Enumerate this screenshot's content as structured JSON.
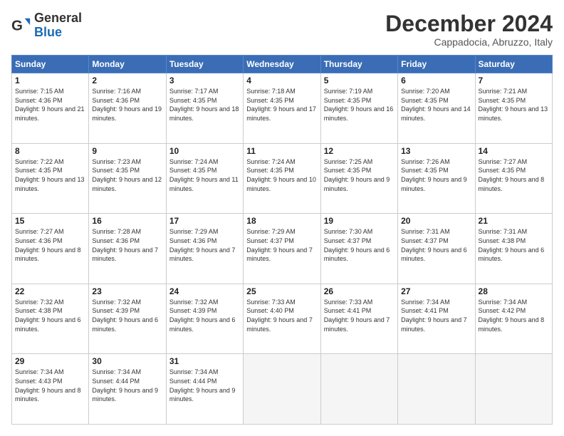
{
  "header": {
    "logo_general": "General",
    "logo_blue": "Blue",
    "month_title": "December 2024",
    "location": "Cappadocia, Abruzzo, Italy"
  },
  "days_of_week": [
    "Sunday",
    "Monday",
    "Tuesday",
    "Wednesday",
    "Thursday",
    "Friday",
    "Saturday"
  ],
  "weeks": [
    [
      {
        "day": "1",
        "sunrise": "7:15 AM",
        "sunset": "4:36 PM",
        "daylight": "9 hours and 21 minutes."
      },
      {
        "day": "2",
        "sunrise": "7:16 AM",
        "sunset": "4:36 PM",
        "daylight": "9 hours and 19 minutes."
      },
      {
        "day": "3",
        "sunrise": "7:17 AM",
        "sunset": "4:35 PM",
        "daylight": "9 hours and 18 minutes."
      },
      {
        "day": "4",
        "sunrise": "7:18 AM",
        "sunset": "4:35 PM",
        "daylight": "9 hours and 17 minutes."
      },
      {
        "day": "5",
        "sunrise": "7:19 AM",
        "sunset": "4:35 PM",
        "daylight": "9 hours and 16 minutes."
      },
      {
        "day": "6",
        "sunrise": "7:20 AM",
        "sunset": "4:35 PM",
        "daylight": "9 hours and 14 minutes."
      },
      {
        "day": "7",
        "sunrise": "7:21 AM",
        "sunset": "4:35 PM",
        "daylight": "9 hours and 13 minutes."
      }
    ],
    [
      {
        "day": "8",
        "sunrise": "7:22 AM",
        "sunset": "4:35 PM",
        "daylight": "9 hours and 13 minutes."
      },
      {
        "day": "9",
        "sunrise": "7:23 AM",
        "sunset": "4:35 PM",
        "daylight": "9 hours and 12 minutes."
      },
      {
        "day": "10",
        "sunrise": "7:24 AM",
        "sunset": "4:35 PM",
        "daylight": "9 hours and 11 minutes."
      },
      {
        "day": "11",
        "sunrise": "7:24 AM",
        "sunset": "4:35 PM",
        "daylight": "9 hours and 10 minutes."
      },
      {
        "day": "12",
        "sunrise": "7:25 AM",
        "sunset": "4:35 PM",
        "daylight": "9 hours and 9 minutes."
      },
      {
        "day": "13",
        "sunrise": "7:26 AM",
        "sunset": "4:35 PM",
        "daylight": "9 hours and 9 minutes."
      },
      {
        "day": "14",
        "sunrise": "7:27 AM",
        "sunset": "4:35 PM",
        "daylight": "9 hours and 8 minutes."
      }
    ],
    [
      {
        "day": "15",
        "sunrise": "7:27 AM",
        "sunset": "4:36 PM",
        "daylight": "9 hours and 8 minutes."
      },
      {
        "day": "16",
        "sunrise": "7:28 AM",
        "sunset": "4:36 PM",
        "daylight": "9 hours and 7 minutes."
      },
      {
        "day": "17",
        "sunrise": "7:29 AM",
        "sunset": "4:36 PM",
        "daylight": "9 hours and 7 minutes."
      },
      {
        "day": "18",
        "sunrise": "7:29 AM",
        "sunset": "4:37 PM",
        "daylight": "9 hours and 7 minutes."
      },
      {
        "day": "19",
        "sunrise": "7:30 AM",
        "sunset": "4:37 PM",
        "daylight": "9 hours and 6 minutes."
      },
      {
        "day": "20",
        "sunrise": "7:31 AM",
        "sunset": "4:37 PM",
        "daylight": "9 hours and 6 minutes."
      },
      {
        "day": "21",
        "sunrise": "7:31 AM",
        "sunset": "4:38 PM",
        "daylight": "9 hours and 6 minutes."
      }
    ],
    [
      {
        "day": "22",
        "sunrise": "7:32 AM",
        "sunset": "4:38 PM",
        "daylight": "9 hours and 6 minutes."
      },
      {
        "day": "23",
        "sunrise": "7:32 AM",
        "sunset": "4:39 PM",
        "daylight": "9 hours and 6 minutes."
      },
      {
        "day": "24",
        "sunrise": "7:32 AM",
        "sunset": "4:39 PM",
        "daylight": "9 hours and 6 minutes."
      },
      {
        "day": "25",
        "sunrise": "7:33 AM",
        "sunset": "4:40 PM",
        "daylight": "9 hours and 7 minutes."
      },
      {
        "day": "26",
        "sunrise": "7:33 AM",
        "sunset": "4:41 PM",
        "daylight": "9 hours and 7 minutes."
      },
      {
        "day": "27",
        "sunrise": "7:34 AM",
        "sunset": "4:41 PM",
        "daylight": "9 hours and 7 minutes."
      },
      {
        "day": "28",
        "sunrise": "7:34 AM",
        "sunset": "4:42 PM",
        "daylight": "9 hours and 8 minutes."
      }
    ],
    [
      {
        "day": "29",
        "sunrise": "7:34 AM",
        "sunset": "4:43 PM",
        "daylight": "9 hours and 8 minutes."
      },
      {
        "day": "30",
        "sunrise": "7:34 AM",
        "sunset": "4:44 PM",
        "daylight": "9 hours and 9 minutes."
      },
      {
        "day": "31",
        "sunrise": "7:34 AM",
        "sunset": "4:44 PM",
        "daylight": "9 hours and 9 minutes."
      },
      null,
      null,
      null,
      null
    ]
  ]
}
